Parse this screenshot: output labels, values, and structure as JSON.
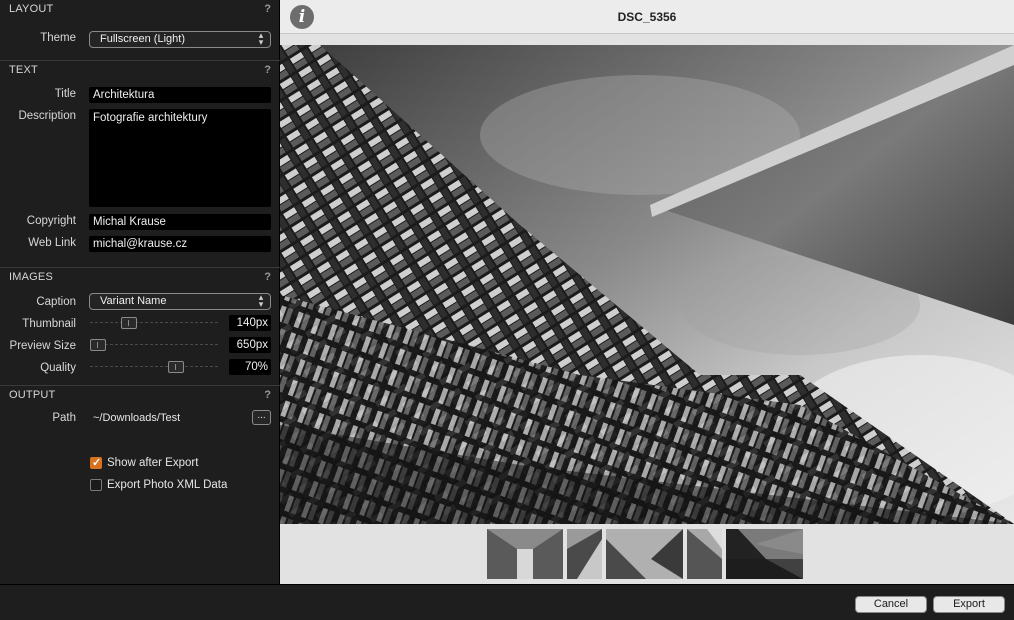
{
  "layout": {
    "header": "LAYOUT",
    "help": "?",
    "theme_label": "Theme",
    "theme_value": "Fullscreen (Light)"
  },
  "text": {
    "header": "TEXT",
    "help": "?",
    "title_label": "Title",
    "title_value": "Architektura",
    "description_label": "Description",
    "description_value": "Fotografie architektury",
    "copyright_label": "Copyright",
    "copyright_value": "Michal Krause",
    "weblink_label": "Web Link",
    "weblink_value": "michal@krause.cz"
  },
  "images": {
    "header": "IMAGES",
    "help": "?",
    "caption_label": "Caption",
    "caption_value": "Variant Name",
    "thumbnail_label": "Thumbnail",
    "thumbnail_value": "140px",
    "thumbnail_level": 0.28,
    "preview_label": "Preview Size",
    "preview_value": "650px",
    "preview_level": 0.0,
    "quality_label": "Quality",
    "quality_value": "70%",
    "quality_level": 0.7
  },
  "output": {
    "header": "OUTPUT",
    "help": "?",
    "path_label": "Path",
    "path_value": "~/Downloads/Test",
    "browse_label": "...",
    "show_after_export": {
      "label": "Show after Export",
      "checked": true
    },
    "export_xml": {
      "label": "Export Photo XML Data",
      "checked": false
    }
  },
  "preview": {
    "title": "DSC_5356",
    "info_icon": "i",
    "thumbnails": [
      "thumb-1",
      "thumb-2",
      "thumb-3",
      "thumb-4",
      "thumb-5"
    ]
  },
  "footer": {
    "cancel_label": "Cancel",
    "export_label": "Export"
  },
  "colors": {
    "accent": "#d7731f",
    "panel_bg": "#1e1e1e",
    "preview_bg": "#e2e2e2"
  }
}
